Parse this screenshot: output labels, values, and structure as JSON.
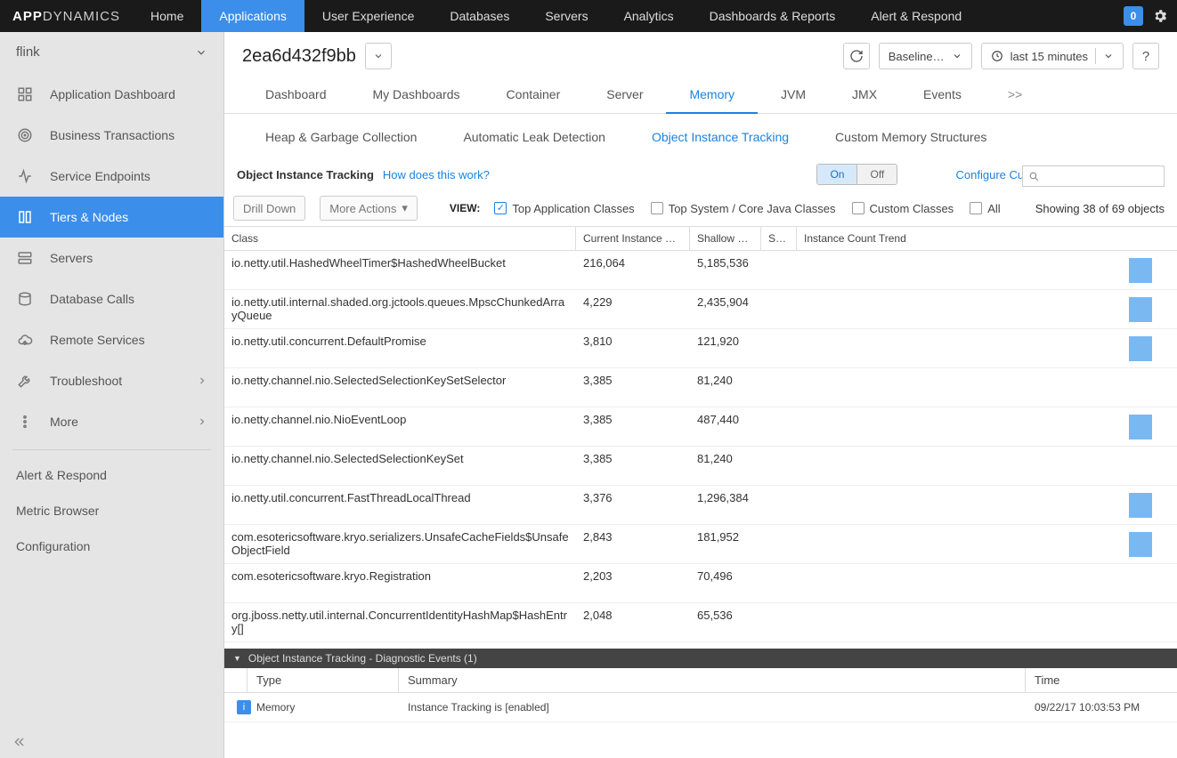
{
  "brand": {
    "strong": "APP",
    "light": "DYNAMICS"
  },
  "topnav": [
    "Home",
    "Applications",
    "User Experience",
    "Databases",
    "Servers",
    "Analytics",
    "Dashboards & Reports",
    "Alert & Respond"
  ],
  "topnav_active_index": 1,
  "badge": "0",
  "sidebar": {
    "app_name": "flink",
    "items": [
      {
        "label": "Application Dashboard",
        "icon": "dashboard"
      },
      {
        "label": "Business Transactions",
        "icon": "target"
      },
      {
        "label": "Service Endpoints",
        "icon": "endpoint"
      },
      {
        "label": "Tiers & Nodes",
        "icon": "tiers",
        "active": true
      },
      {
        "label": "Servers",
        "icon": "servers"
      },
      {
        "label": "Database Calls",
        "icon": "database"
      },
      {
        "label": "Remote Services",
        "icon": "cloud"
      },
      {
        "label": "Troubleshoot",
        "icon": "tools",
        "chev": true
      },
      {
        "label": "More",
        "icon": "more",
        "chev": true
      }
    ],
    "plain": [
      "Alert & Respond",
      "Metric Browser",
      "Configuration"
    ]
  },
  "header": {
    "title": "2ea6d432f9bb",
    "baseline_label": "Baseline…",
    "range_label": "last 15 minutes"
  },
  "tabs1": [
    "Dashboard",
    "My Dashboards",
    "Container",
    "Server",
    "Memory",
    "JVM",
    "JMX",
    "Events",
    ">>"
  ],
  "tabs1_active_index": 4,
  "tabs2": [
    "Heap & Garbage Collection",
    "Automatic Leak Detection",
    "Object Instance Tracking",
    "Custom Memory Structures"
  ],
  "tabs2_active_index": 2,
  "section": {
    "title": "Object Instance Tracking",
    "help_link": "How does this work?",
    "toggle_on": "On",
    "toggle_off": "Off",
    "config_link": "Configure Custom Classes to Track"
  },
  "filter": {
    "drill": "Drill Down",
    "more": "More Actions",
    "view_label": "VIEW:",
    "checks": [
      {
        "label": "Top Application Classes",
        "checked": true
      },
      {
        "label": "Top System / Core Java Classes",
        "checked": false
      },
      {
        "label": "Custom Classes",
        "checked": false
      },
      {
        "label": "All",
        "checked": false
      }
    ],
    "count_text": "Showing 38 of 69 objects"
  },
  "table": {
    "headers": {
      "class": "Class",
      "count": "Current Instance C… ▲",
      "size": "Shallow Siz…",
      "status": "Status",
      "trend": "Instance Count Trend"
    },
    "rows": [
      {
        "class": "io.netty.util.HashedWheelTimer$HashedWheelBucket",
        "count": "216,064",
        "size": "5,185,536",
        "spark": true
      },
      {
        "class": "io.netty.util.internal.shaded.org.jctools.queues.MpscChunkedArrayQueue",
        "count": "4,229",
        "size": "2,435,904",
        "spark": true
      },
      {
        "class": "io.netty.util.concurrent.DefaultPromise",
        "count": "3,810",
        "size": "121,920",
        "spark": true
      },
      {
        "class": "io.netty.channel.nio.SelectedSelectionKeySetSelector",
        "count": "3,385",
        "size": "81,240",
        "spark": false
      },
      {
        "class": "io.netty.channel.nio.NioEventLoop",
        "count": "3,385",
        "size": "487,440",
        "spark": true
      },
      {
        "class": "io.netty.channel.nio.SelectedSelectionKeySet",
        "count": "3,385",
        "size": "81,240",
        "spark": false
      },
      {
        "class": "io.netty.util.concurrent.FastThreadLocalThread",
        "count": "3,376",
        "size": "1,296,384",
        "spark": true
      },
      {
        "class": "com.esotericsoftware.kryo.serializers.UnsafeCacheFields$UnsafeObjectField",
        "count": "2,843",
        "size": "181,952",
        "spark": true
      },
      {
        "class": "com.esotericsoftware.kryo.Registration",
        "count": "2,203",
        "size": "70,496",
        "spark": false
      },
      {
        "class": "org.jboss.netty.util.internal.ConcurrentIdentityHashMap$HashEntry[]",
        "count": "2,048",
        "size": "65,536",
        "spark": false
      }
    ]
  },
  "footer": {
    "title": "Object Instance Tracking - Diagnostic Events (1)",
    "headers": {
      "type": "Type",
      "summary": "Summary",
      "time": "Time"
    },
    "row": {
      "type": "Memory",
      "summary": "Instance Tracking is [enabled]",
      "time": "09/22/17 10:03:53 PM"
    }
  }
}
